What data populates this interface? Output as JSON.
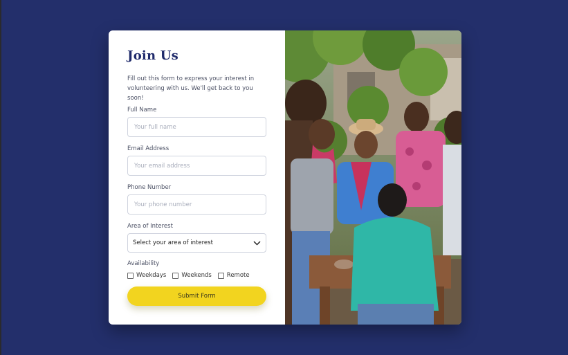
{
  "form": {
    "title": "Join Us",
    "intro": "Fill out this form to express your interest in volunteering with us. We'll get back to you soon!",
    "full_name": {
      "label": "Full Name",
      "placeholder": "Your full name"
    },
    "email": {
      "label": "Email Address",
      "placeholder": "Your email address"
    },
    "phone": {
      "label": "Phone Number",
      "placeholder": "Your phone number"
    },
    "interest": {
      "label": "Area of Interest",
      "selected": "Select your area of interest"
    },
    "availability": {
      "label": "Availability",
      "options": [
        "Weekdays",
        "Weekends",
        "Remote"
      ]
    },
    "submit_label": "Submit Form"
  },
  "theme": {
    "background": "#232f6b",
    "title_color": "#1f2a6b",
    "button_color": "#f2d41f"
  },
  "image": {
    "description_icon": "volunteers-photo"
  }
}
